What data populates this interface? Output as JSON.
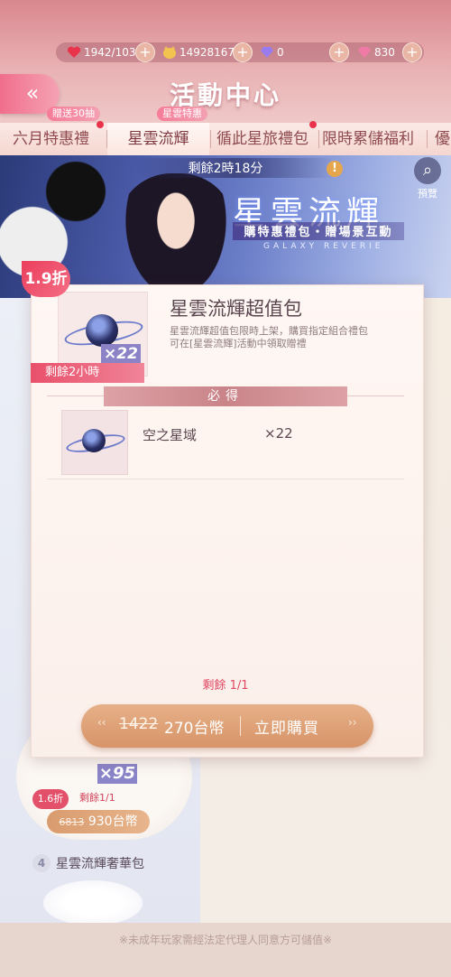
{
  "resources": {
    "stamina": "1942/103",
    "gold": "14928167",
    "diamond": "0",
    "star": "830"
  },
  "header": {
    "back_label": "«",
    "title": "活動中心"
  },
  "tabs": [
    {
      "label": "六月特惠禮",
      "badge": "贈送30抽"
    },
    {
      "label": "星雲流輝",
      "badge": "星雲特惠"
    },
    {
      "label": "循此星旅禮包",
      "badge": ""
    },
    {
      "label": "限時累儲福利",
      "badge": ""
    },
    {
      "label": "優",
      "badge": ""
    }
  ],
  "banner": {
    "timer": "剩餘2時18分",
    "info": "!",
    "preview_label": "預覽",
    "title": "星雲流輝",
    "subtitle": "購特惠禮包・贈場景互動",
    "english": "GALAXY REVERIE"
  },
  "modal": {
    "discount": "1.9折",
    "title": "星雲流輝超值包",
    "description": "星雲流輝超值包限時上架，購買指定組合禮包可在[星雲流輝]活動中領取贈禮",
    "qty_tag": "×22",
    "time_left": "剩餘2小時",
    "must_label": "必得",
    "item": {
      "name": "空之星域",
      "qty": "×22"
    },
    "remain": "剩餘 1/1",
    "price_old": "1422",
    "price_new": "270台幣",
    "buy_label": "立即購買"
  },
  "background_list": {
    "qty_tag": "×95",
    "discount": "1.6折",
    "remain": "剩餘1/1",
    "price_old": "6813",
    "price_new": "930台幣",
    "num": "4",
    "name": "星雲流輝奢華包"
  },
  "footer": {
    "notice": "※未成年玩家需經法定代理人同意方可儲值※"
  },
  "colors": {
    "accent": "#e8334a",
    "button": "#d79468",
    "header": "#d9878f"
  }
}
